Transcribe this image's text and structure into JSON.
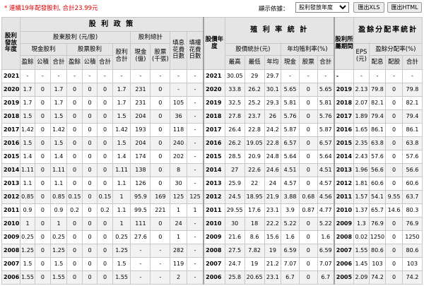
{
  "summary": "* 連續19年配發股利, 合計23.99元",
  "controls": {
    "sort_label": "顯示依據：",
    "sort_selected": "股利發放年度",
    "export_xls": "匯出XLS",
    "export_html": "匯出HTML"
  },
  "headers": {
    "section_dividend": "股 利 政 策",
    "section_yield": "殖 利 率 統 計",
    "section_payout": "盈餘分配率統計",
    "year_col_dividend": "股利發放年度",
    "shareholder_dividend": "股東股利 (元/股)",
    "dividend_total": "股利總計",
    "cash_dividend": "現金股利",
    "stock_dividend": "股票股利",
    "fill_days": "填息花費日數",
    "fill_rights_days": "填權花費日數",
    "year_col_yield": "股價年度",
    "price_stats": "股價統計(元)",
    "avg_yield": "年均殖利率(%)",
    "year_col_payout": "股利所屬期間",
    "eps": "EPS (元)",
    "payout_ratio": "盈餘分配率(%)",
    "surplus": "盈餘",
    "reserve": "公積",
    "total": "合計",
    "stock_total": "股利合計",
    "cash_billion": "現金(億)",
    "stock_thousand": "股票(千張)",
    "highest": "最高",
    "lowest": "最低",
    "annual_avg": "年均",
    "cash": "現金",
    "stock": "股票",
    "alloc_interest": "配息",
    "alloc_shares": "配股",
    "payout_total": "合計"
  },
  "rows": [
    [
      "2021",
      "-",
      "-",
      "-",
      "-",
      "-",
      "-",
      "-",
      "-",
      "-",
      "-",
      "-",
      "2021",
      "30.05",
      "29",
      "29.7",
      "-",
      "-",
      "-",
      "-",
      "-",
      "-",
      "-",
      "-"
    ],
    [
      "2020",
      "1.7",
      "0",
      "1.7",
      "0",
      "0",
      "0",
      "1.7",
      "231",
      "0",
      "-",
      "-",
      "2020",
      "33.8",
      "26.2",
      "30.1",
      "5.65",
      "0",
      "5.65",
      "2019",
      "2.13",
      "79.8",
      "0",
      "79.8"
    ],
    [
      "2019",
      "1.7",
      "0",
      "1.7",
      "0",
      "0",
      "0",
      "1.7",
      "231",
      "0",
      "105",
      "-",
      "2019",
      "32.5",
      "25.2",
      "29.3",
      "5.81",
      "0",
      "5.81",
      "2018",
      "2.07",
      "82.1",
      "0",
      "82.1"
    ],
    [
      "2018",
      "1.5",
      "0",
      "1.5",
      "0",
      "0",
      "0",
      "1.5",
      "204",
      "0",
      "36",
      "-",
      "2018",
      "27.8",
      "23.7",
      "26",
      "5.76",
      "0",
      "5.76",
      "2017",
      "1.89",
      "79.4",
      "0",
      "79.4"
    ],
    [
      "2017",
      "1.42",
      "0",
      "1.42",
      "0",
      "0",
      "0",
      "1.42",
      "193",
      "0",
      "118",
      "-",
      "2017",
      "26.4",
      "22.8",
      "24.2",
      "5.87",
      "0",
      "5.87",
      "2016",
      "1.65",
      "86.1",
      "0",
      "86.1"
    ],
    [
      "2016",
      "1.5",
      "0",
      "1.5",
      "0",
      "0",
      "0",
      "1.5",
      "204",
      "0",
      "240",
      "-",
      "2016",
      "26.2",
      "19.05",
      "22.8",
      "6.57",
      "0",
      "6.57",
      "2015",
      "2.35",
      "63.8",
      "0",
      "63.8"
    ],
    [
      "2015",
      "1.4",
      "0",
      "1.4",
      "0",
      "0",
      "0",
      "1.4",
      "174",
      "0",
      "202",
      "-",
      "2015",
      "28.5",
      "20.9",
      "24.8",
      "5.64",
      "0",
      "5.64",
      "2014",
      "2.43",
      "57.6",
      "0",
      "57.6"
    ],
    [
      "2014",
      "1.11",
      "0",
      "1.11",
      "0",
      "0",
      "0",
      "1.11",
      "138",
      "0",
      "8",
      "-",
      "2014",
      "27",
      "22.6",
      "24.6",
      "4.51",
      "0",
      "4.51",
      "2013",
      "1.96",
      "56.6",
      "0",
      "56.6"
    ],
    [
      "2013",
      "1.1",
      "0",
      "1.1",
      "0",
      "0",
      "0",
      "1.1",
      "126",
      "0",
      "30",
      "-",
      "2013",
      "25.9",
      "22",
      "24",
      "4.57",
      "0",
      "4.57",
      "2012",
      "1.81",
      "60.6",
      "0",
      "60.6"
    ],
    [
      "2012",
      "0.85",
      "0",
      "0.85",
      "0.15",
      "0",
      "0.15",
      "1",
      "95.9",
      "169",
      "125",
      "125",
      "2012",
      "24.5",
      "18.95",
      "21.9",
      "3.88",
      "0.68",
      "4.56",
      "2011",
      "1.57",
      "54.1",
      "9.55",
      "63.7"
    ],
    [
      "2011",
      "0.9",
      "0",
      "0.9",
      "0.2",
      "0",
      "0.2",
      "1.1",
      "99.5",
      "221",
      "1",
      "1",
      "2011",
      "29.55",
      "17.6",
      "23.1",
      "3.9",
      "0.87",
      "4.77",
      "2010",
      "1.37",
      "65.7",
      "14.6",
      "80.3"
    ],
    [
      "2010",
      "1",
      "0",
      "1",
      "0",
      "0",
      "0",
      "1",
      "111",
      "0",
      "24",
      "-",
      "2010",
      "30",
      "18",
      "22.2",
      "5.22",
      "0",
      "5.22",
      "2009",
      "1.3",
      "76.9",
      "0",
      "76.9"
    ],
    [
      "2009",
      "0.25",
      "0",
      "0.25",
      "0",
      "0",
      "0",
      "0.25",
      "27.6",
      "0",
      "1",
      "-",
      "2009",
      "21.6",
      "8.6",
      "15.6",
      "1.6",
      "0",
      "1.6",
      "2008",
      "0.02",
      "1250",
      "0",
      "1250"
    ],
    [
      "2008",
      "1.25",
      "0",
      "1.25",
      "0",
      "0",
      "0",
      "1.25",
      "-",
      "-",
      "282",
      "-",
      "2008",
      "27.5",
      "7.82",
      "19",
      "6.59",
      "0",
      "6.59",
      "2007",
      "1.55",
      "80.6",
      "0",
      "80.6"
    ],
    [
      "2007",
      "1.5",
      "0",
      "1.5",
      "0",
      "0",
      "0",
      "1.5",
      "-",
      "-",
      "119",
      "-",
      "2007",
      "24.7",
      "19",
      "21.2",
      "7.07",
      "0",
      "7.07",
      "2006",
      "1.45",
      "103",
      "0",
      "103"
    ],
    [
      "2006",
      "1.55",
      "0",
      "1.55",
      "0",
      "0",
      "0",
      "1.55",
      "-",
      "-",
      "2",
      "-",
      "2006",
      "25.8",
      "20.65",
      "23.1",
      "6.7",
      "0",
      "6.7",
      "2005",
      "2.09",
      "74.2",
      "0",
      "74.2"
    ]
  ]
}
